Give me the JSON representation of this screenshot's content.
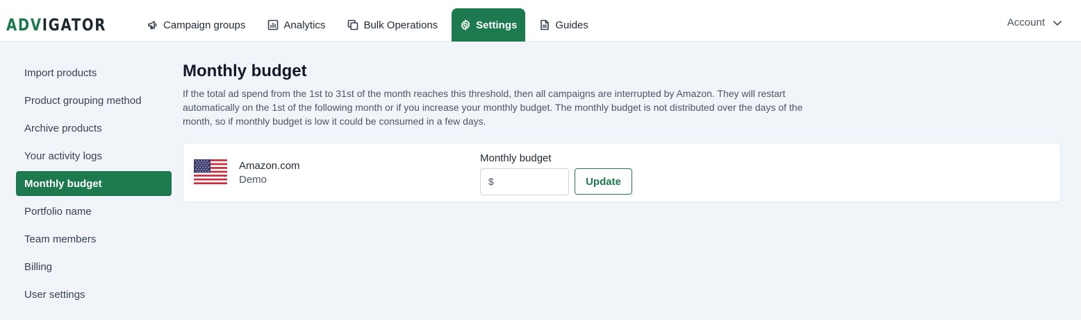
{
  "brand": {
    "logo_part1": "ADV",
    "logo_part2": "IGATOR",
    "accent_color": "#1d7a4e"
  },
  "nav": {
    "items": [
      {
        "label": "Campaign groups",
        "icon": "megaphone-icon"
      },
      {
        "label": "Analytics",
        "icon": "bar-chart-icon"
      },
      {
        "label": "Bulk Operations",
        "icon": "copy-icon"
      },
      {
        "label": "Settings",
        "icon": "gear-icon",
        "active": true
      },
      {
        "label": "Guides",
        "icon": "document-icon"
      }
    ],
    "account_label": "Account"
  },
  "sidebar": {
    "items": [
      {
        "label": "Import products"
      },
      {
        "label": "Product grouping method"
      },
      {
        "label": "Archive products"
      },
      {
        "label": "Your activity logs"
      },
      {
        "label": "Monthly budget",
        "active": true
      },
      {
        "label": "Portfolio name"
      },
      {
        "label": "Team members"
      },
      {
        "label": "Billing"
      },
      {
        "label": "User settings"
      }
    ]
  },
  "main": {
    "title": "Monthly budget",
    "description": "If the total ad spend from the 1st to 31st of the month reaches this threshold, then all campaigns are interrupted by Amazon. They will restart automatically on the 1st of the following month or if you increase your monthly budget. The monthly budget is not distributed over the days of the month, so if monthly budget is low it could be consumed in a few days.",
    "card": {
      "flag": "us-flag-icon",
      "marketplace": "Amazon.com",
      "profile": "Demo",
      "budget_label": "Monthly budget",
      "currency_prefix": "$",
      "budget_value": "",
      "update_label": "Update"
    }
  }
}
